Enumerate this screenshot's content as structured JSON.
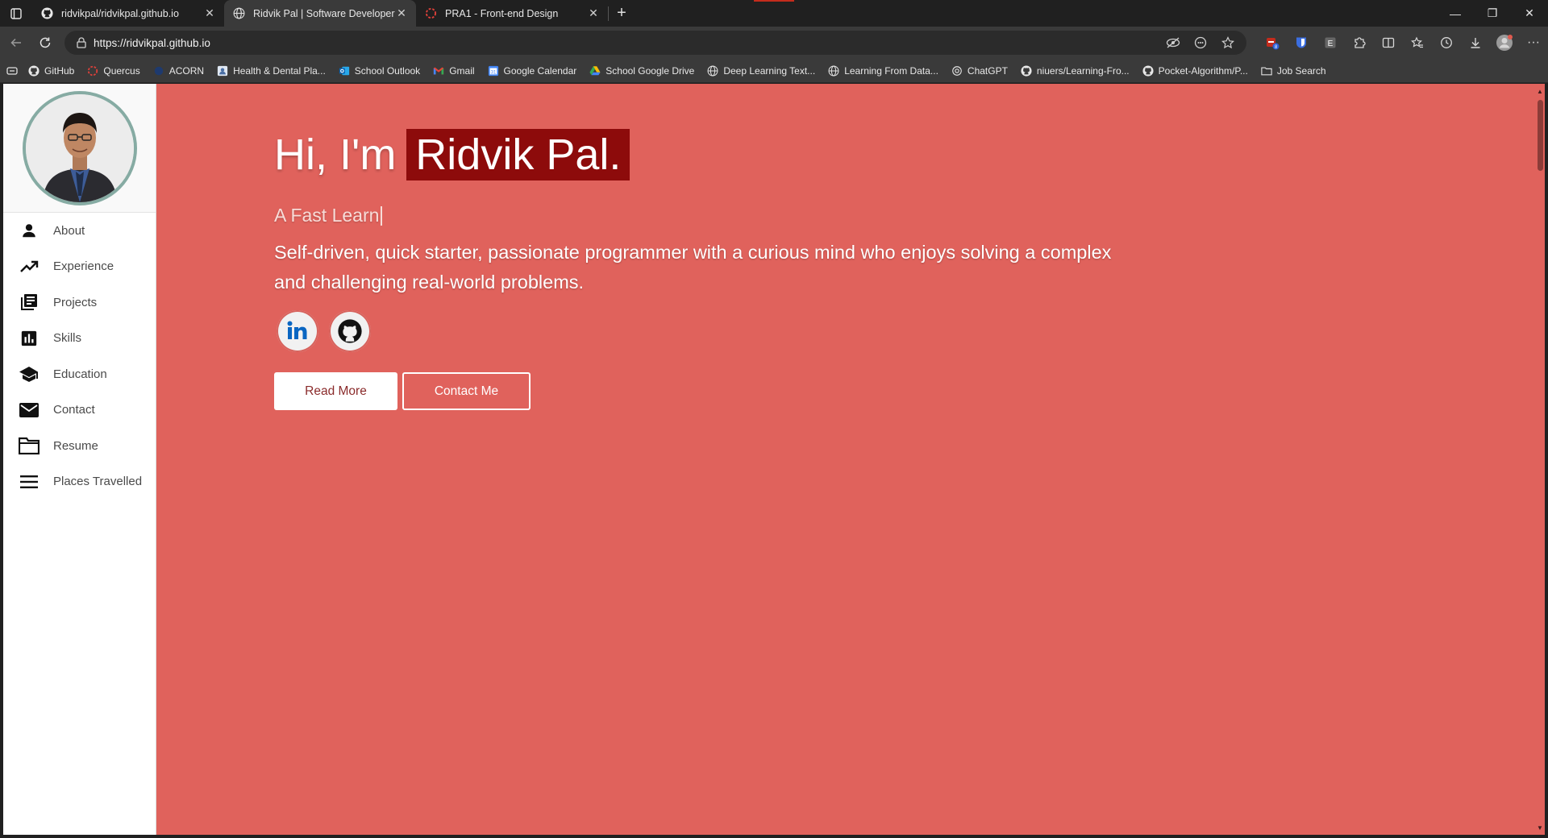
{
  "browser": {
    "tabs": [
      {
        "label": "ridvikpal/ridvikpal.github.io",
        "icon": "github-icon"
      },
      {
        "label": "Ridvik Pal | Software Developer",
        "icon": "globe-icon",
        "active": true
      },
      {
        "label": "PRA1 - Front-end Design",
        "icon": "loading-icon"
      }
    ],
    "url": "https://ridvikpal.github.io",
    "bookmarks": [
      {
        "label": "GitHub",
        "icon": "github-icon"
      },
      {
        "label": "Quercus",
        "icon": "quercus-icon"
      },
      {
        "label": "ACORN",
        "icon": "acorn-icon"
      },
      {
        "label": "Health & Dental Pla...",
        "icon": "health-icon"
      },
      {
        "label": "School Outlook",
        "icon": "outlook-icon"
      },
      {
        "label": "Gmail",
        "icon": "gmail-icon"
      },
      {
        "label": "Google Calendar",
        "icon": "calendar-icon"
      },
      {
        "label": "School Google Drive",
        "icon": "drive-icon"
      },
      {
        "label": "Deep Learning Text...",
        "icon": "globe-icon"
      },
      {
        "label": "Learning From Data...",
        "icon": "globe-icon"
      },
      {
        "label": "ChatGPT",
        "icon": "chatgpt-icon"
      },
      {
        "label": "niuers/Learning-Fro...",
        "icon": "github-icon"
      },
      {
        "label": "Pocket-Algorithm/P...",
        "icon": "github-icon"
      },
      {
        "label": "Job Search",
        "icon": "folder-icon"
      }
    ],
    "extension_badge": "8"
  },
  "sidebar": {
    "items": [
      {
        "label": "About",
        "icon": "person-icon"
      },
      {
        "label": "Experience",
        "icon": "trending-up-icon"
      },
      {
        "label": "Projects",
        "icon": "library-books-icon"
      },
      {
        "label": "Skills",
        "icon": "bar-chart-icon"
      },
      {
        "label": "Education",
        "icon": "school-icon"
      },
      {
        "label": "Contact",
        "icon": "mail-icon"
      },
      {
        "label": "Resume",
        "icon": "folder-icon"
      },
      {
        "label": "Places Travelled",
        "icon": "menu-icon"
      }
    ]
  },
  "hero": {
    "greeting": "Hi, I'm",
    "name": "Ridvik Pal.",
    "typed_text": "A Fast Learn",
    "description": "Self-driven, quick starter, passionate programmer with a curious mind who enjoys solving a complex and challenging real-world problems.",
    "read_more": "Read More",
    "contact_me": "Contact Me"
  },
  "colors": {
    "hero_bg": "#e0625c",
    "name_highlight": "#8d0b0b",
    "avatar_border": "#86aba3"
  }
}
